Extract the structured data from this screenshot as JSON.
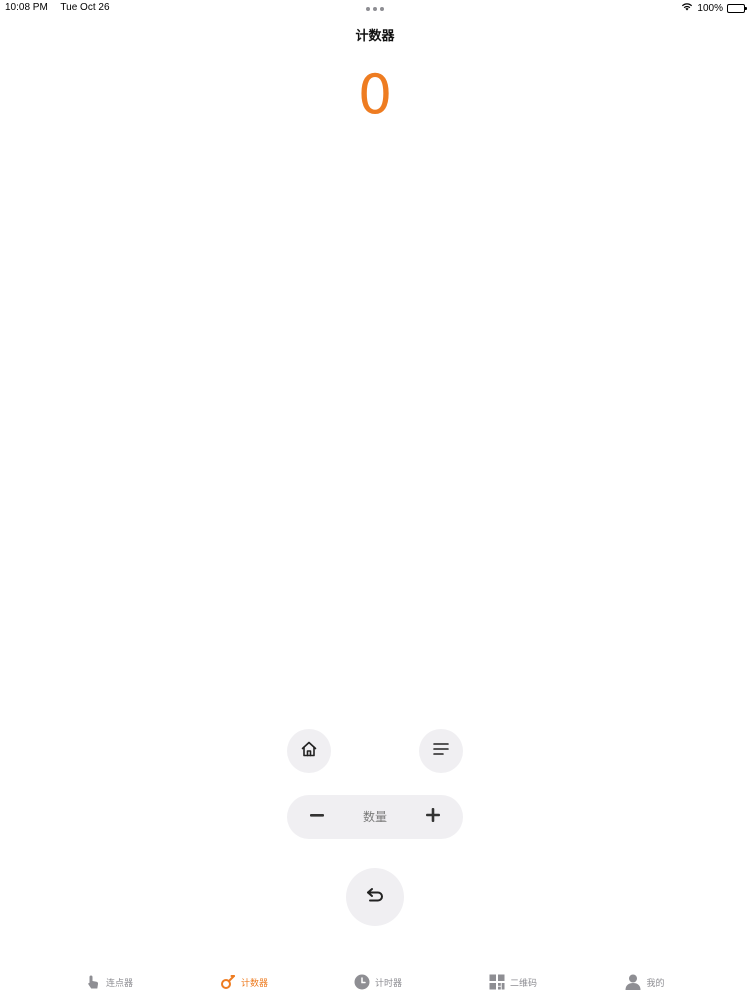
{
  "status_bar": {
    "time": "10:08 PM",
    "date": "Tue Oct 26",
    "battery": "100%"
  },
  "nav": {
    "title": "计数器"
  },
  "counter": {
    "value": "0",
    "color": "#ee7c21"
  },
  "controls": {
    "stepper_label": "数量",
    "minus_icon": "minus-icon",
    "plus_icon": "plus-icon",
    "home_icon": "home-icon",
    "menu_icon": "menu-lines-icon",
    "undo_icon": "undo-arrow-icon"
  },
  "tabs": [
    {
      "label": "连点器",
      "icon": "tap-hand-icon",
      "active": false
    },
    {
      "label": "计数器",
      "icon": "counter-icon",
      "active": true
    },
    {
      "label": "计时器",
      "icon": "clock-icon",
      "active": false
    },
    {
      "label": "二维码",
      "icon": "qr-code-icon",
      "active": false
    },
    {
      "label": "我的",
      "icon": "person-icon",
      "active": false
    }
  ],
  "colors": {
    "accent": "#ee7c21",
    "button_bg": "#f0eff2",
    "inactive_tab": "#8e8e93"
  }
}
